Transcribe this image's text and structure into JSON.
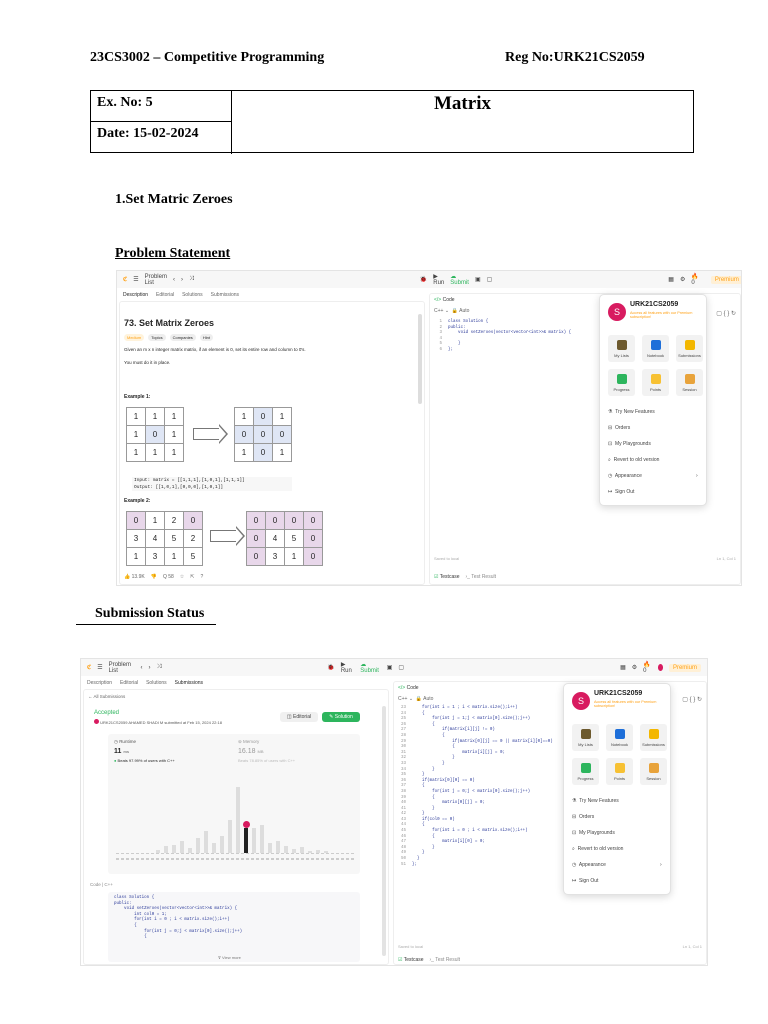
{
  "header": {
    "course": "23CS3002 – Competitive Programming",
    "reg": "Reg No:URK21CS2059"
  },
  "exercise": {
    "no": "Ex. No: 5",
    "date": "Date: 15-02-2024",
    "title": "Matrix"
  },
  "sections": {
    "problem_title": "1.Set Matric Zeroes",
    "problem_statement": "Problem Statement",
    "submission_status": "Submission Status"
  },
  "app": {
    "problem_list": "Problem List",
    "run": "Run",
    "submit": "Submit",
    "premium": "Premium",
    "notif": "0",
    "tabs": {
      "description": "Description",
      "editorial": "Editorial",
      "solutions": "Solutions",
      "submissions": "Submissions"
    },
    "code_tab": "Code",
    "lang": "C++",
    "auto": "Auto",
    "saved": "Saved to local",
    "pos": "Ln 1, Col 1",
    "testcase": "Testcase",
    "test_result": "Test Result"
  },
  "problem": {
    "title": "73. Set Matrix Zeroes",
    "tags": [
      "Medium",
      "Topics",
      "Companies",
      "Hint"
    ],
    "desc": "Given an m x n integer matrix matrix, if an element is 0, set its entire row and column to 0's.",
    "inplace": "You must do it in place.",
    "ex1": "Example 1:",
    "ex2": "Example 2:",
    "ex1_in": [
      [
        1,
        1,
        1
      ],
      [
        1,
        0,
        1
      ],
      [
        1,
        1,
        1
      ]
    ],
    "ex1_out": [
      [
        1,
        0,
        1
      ],
      [
        0,
        0,
        0
      ],
      [
        1,
        0,
        1
      ]
    ],
    "ex1_input": "Input: matrix = [[1,1,1],[1,0,1],[1,1,1]]",
    "ex1_output": "Output: [[1,0,1],[0,0,0],[1,0,1]]",
    "ex2_in": [
      [
        0,
        1,
        2,
        0
      ],
      [
        3,
        4,
        5,
        2
      ],
      [
        1,
        3,
        1,
        5
      ]
    ],
    "ex2_out": [
      [
        0,
        0,
        0,
        0
      ],
      [
        0,
        4,
        5,
        0
      ],
      [
        0,
        3,
        1,
        0
      ]
    ],
    "likes": "13.9K",
    "dislikes": "",
    "comments": "Q 58"
  },
  "code1": [
    "class Solution {",
    "public:",
    "    void setZeroes(vector<vector<int>>& matrix) {",
    "",
    "    }",
    "};"
  ],
  "menu": {
    "user": "URK21CS2059",
    "initial": "S",
    "promo": "Access all features with our Premium subscription!",
    "tiles": [
      "My Lists",
      "Notebook",
      "Submissions",
      "Progress",
      "Points",
      "Session"
    ],
    "items": [
      "Try New Features",
      "Orders",
      "My Playgrounds",
      "Revert to old version",
      "Appearance",
      "Sign Out"
    ]
  },
  "submission": {
    "all": "All Submissions",
    "accepted": "Accepted",
    "by": "URK21CS2059 AHAMED SHADI M submitted at Feb 15, 2024 22:18",
    "editorial": "Editorial",
    "solution": "Solution",
    "runtime_label": "Runtime",
    "runtime": "11",
    "runtime_unit": "ms",
    "beats_rt": "Beats 97.99% of users with C++",
    "memory_label": "Memory",
    "memory": "16.18",
    "memory_unit": "MB",
    "beats_mem": "Beats 78.85% of users with C++",
    "code_label": "Code | C++",
    "view_more": "View more",
    "code": [
      "class Solution {",
      "public:",
      "    void setZeroes(vector<vector<int>>& matrix) {",
      "        int col0 = 1;",
      "        for(int i = 0 ; i < matrix.size();i++)",
      "        {",
      "            for(int j = 0;j < matrix[0].size();j++)",
      "            {"
    ],
    "right_code": [
      "    for(int i = 1 ; i < matrix.size();i++)",
      "    {",
      "        for(int j = 1;j < matrix[0].size();j++)",
      "        {",
      "            if(matrix[i][j] != 0)",
      "            {",
      "                if(matrix[0][j] == 0 || matrix[i][0]==0)",
      "                {",
      "                    matrix[i][j] = 0;",
      "                }",
      "            }",
      "        }",
      "    }",
      "    if(matrix[0][0] == 0)",
      "    {",
      "        for(int j = 0;j < matrix[0].size();j++)",
      "        {",
      "            matrix[0][j] = 0;",
      "        }",
      "    }",
      "    if(col0 == 0)",
      "    {",
      "        for(int i = 0 ; i < matrix.size();i++)",
      "        {",
      "            matrix[i][0] = 0;",
      "        }",
      "    }",
      "  }",
      "};"
    ],
    "right_start": 23
  },
  "colors": {
    "accent": "#ffa116",
    "green": "#2db55d",
    "pink": "#d81b60",
    "blue": "#1a73e8"
  }
}
